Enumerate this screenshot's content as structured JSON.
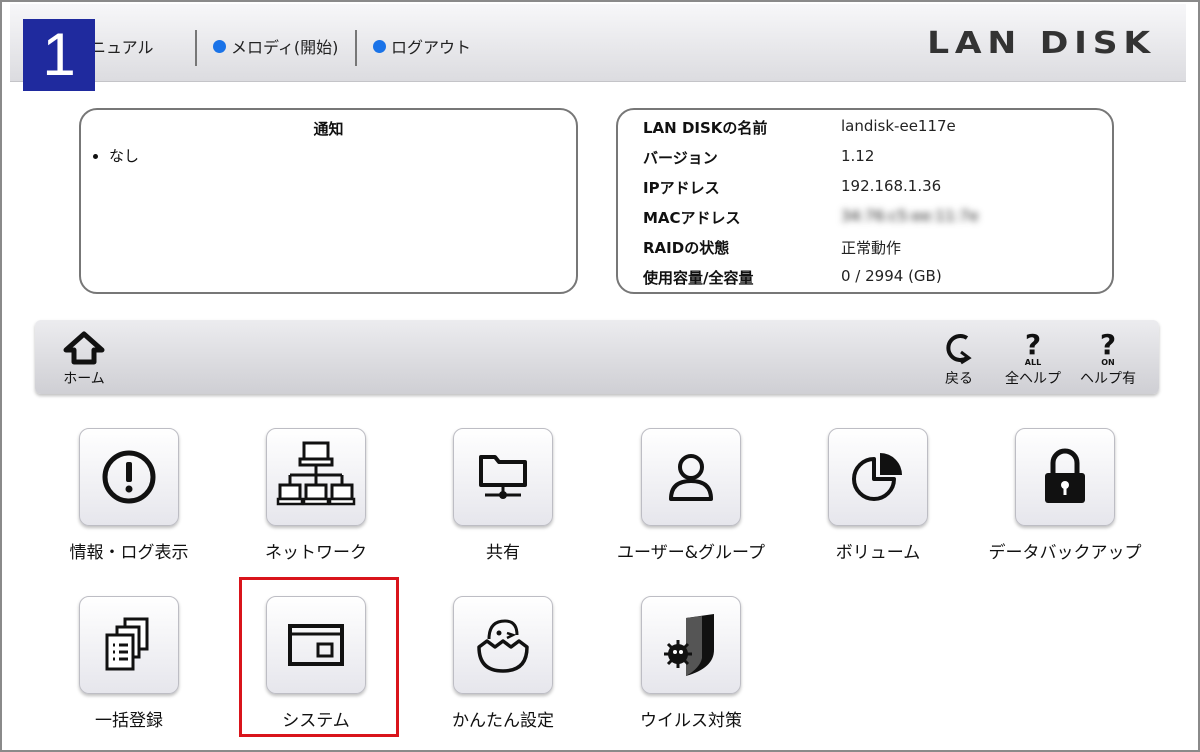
{
  "step": "1",
  "header": {
    "links": [
      {
        "label": "ニュアル",
        "dot": false
      },
      {
        "label": "メロディ(開始)",
        "dot": true
      },
      {
        "label": "ログアウト",
        "dot": true
      }
    ],
    "logo": "LAN DISK"
  },
  "notice": {
    "title": "通知",
    "items": [
      "なし"
    ]
  },
  "status": {
    "rows": [
      {
        "key": "LAN DISKの名前",
        "value": "landisk-ee117e"
      },
      {
        "key": "バージョン",
        "value": "1.12"
      },
      {
        "key": "IPアドレス",
        "value": "192.168.1.36"
      },
      {
        "key": "MACアドレス",
        "value": "34:76:c5:ee:11:7e"
      },
      {
        "key": "RAIDの状態",
        "value": "正常動作"
      },
      {
        "key": "使用容量/全容量",
        "value": "0 / 2994 (GB)"
      }
    ]
  },
  "toolbar": {
    "home": "ホーム",
    "back": "戻る",
    "all_help": "全ヘルプ",
    "help_on": "ヘルプ有",
    "all_badge": "ALL",
    "on_badge": "ON"
  },
  "tiles": [
    {
      "label": "情報・ログ表示",
      "icon": "info-icon"
    },
    {
      "label": "ネットワーク",
      "icon": "network-icon"
    },
    {
      "label": "共有",
      "icon": "shared-folder-icon"
    },
    {
      "label": "ユーザー&グループ",
      "icon": "user-icon"
    },
    {
      "label": "ボリューム",
      "icon": "pie-chart-icon"
    },
    {
      "label": "データバックアップ",
      "icon": "lock-icon"
    },
    {
      "label": "一括登録",
      "icon": "bulk-documents-icon"
    },
    {
      "label": "システム",
      "icon": "system-window-icon"
    },
    {
      "label": "かんたん設定",
      "icon": "hatching-chick-icon"
    },
    {
      "label": "ウイルス対策",
      "icon": "virus-shield-icon"
    }
  ],
  "highlighted_tile": "システム",
  "colors": {
    "highlight": "#d9141b",
    "badge": "#1f2a9e",
    "link_dot": "#1a73e8"
  }
}
